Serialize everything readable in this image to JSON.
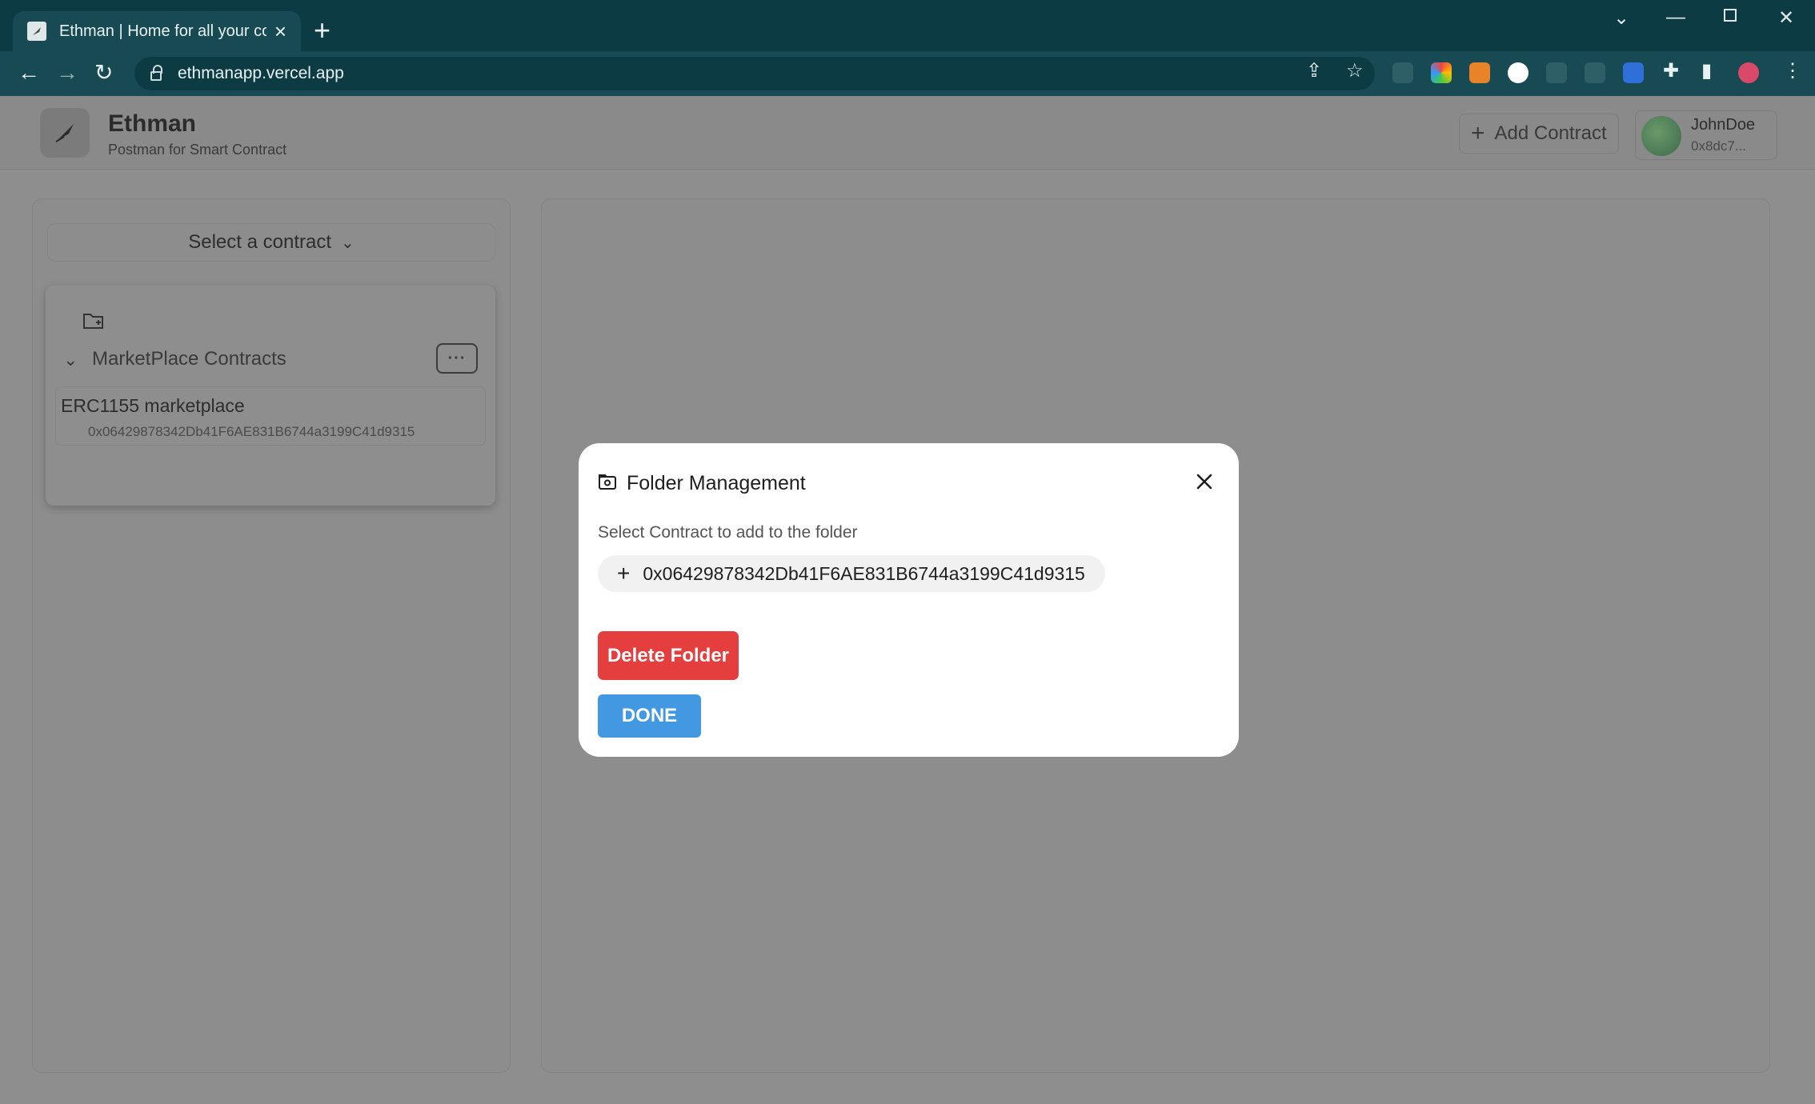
{
  "browser": {
    "tab_title": "Ethman | Home for all your contr",
    "url": "ethmanapp.vercel.app"
  },
  "header": {
    "app_name": "Ethman",
    "tagline": "Postman for Smart Contract",
    "add_contract_label": "Add Contract",
    "user_name": "JohnDoe",
    "user_address": "0x8dc7..."
  },
  "sidebar": {
    "select_label": "Select a contract",
    "folder_name": "MarketPlace Contracts",
    "folder_more": "···",
    "contracts": [
      {
        "name": "ERC1155 marketplace",
        "address": "0x06429878342Db41F6AE831B6744a3199C41d9315"
      }
    ]
  },
  "modal": {
    "title": "Folder Management",
    "label": "Select Contract to add to the folder",
    "contract_address": "0x06429878342Db41F6AE831B6744a3199C41d9315",
    "delete_label": "Delete Folder",
    "done_label": "DONE"
  },
  "colors": {
    "delete": "#e53e3e",
    "done": "#4299e1",
    "chrome": "#0c3b43"
  }
}
